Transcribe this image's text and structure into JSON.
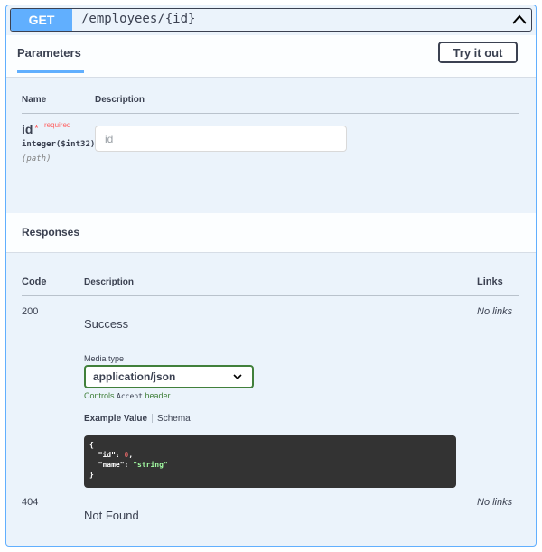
{
  "operation": {
    "method": "GET",
    "path": "/employees/{id}"
  },
  "tabs": {
    "parameters_label": "Parameters",
    "try_button": "Try it out"
  },
  "parameters_table": {
    "name_header": "Name",
    "description_header": "Description",
    "params": [
      {
        "name": "id",
        "required_mark": "*",
        "required_text": "required",
        "type": "integer($int32)",
        "in": "(path)",
        "placeholder": "id"
      }
    ]
  },
  "responses": {
    "title": "Responses",
    "code_header": "Code",
    "description_header": "Description",
    "links_header": "Links",
    "items": [
      {
        "code": "200",
        "description": "Success",
        "links": "No links",
        "media_type_label": "Media type",
        "media_type_value": "application/json",
        "controls_prefix": "Controls",
        "controls_code": "Accept",
        "controls_suffix": "header.",
        "example_tab": "Example Value",
        "schema_tab": "Schema",
        "example": {
          "open": "{",
          "key1": "\"id\"",
          "val1": "0",
          "key2": "\"name\"",
          "val2": "\"string\"",
          "close": "}"
        }
      },
      {
        "code": "404",
        "description": "Not Found",
        "links": "No links"
      }
    ]
  },
  "colors": {
    "get_accent": "#61affe",
    "block_bg": "#ebf3fb",
    "required": "#ff6060",
    "media_green": "#41803b",
    "code_bg": "#333333"
  },
  "icons": {
    "collapse": "chevron-up-icon",
    "select": "chevron-down-icon"
  }
}
